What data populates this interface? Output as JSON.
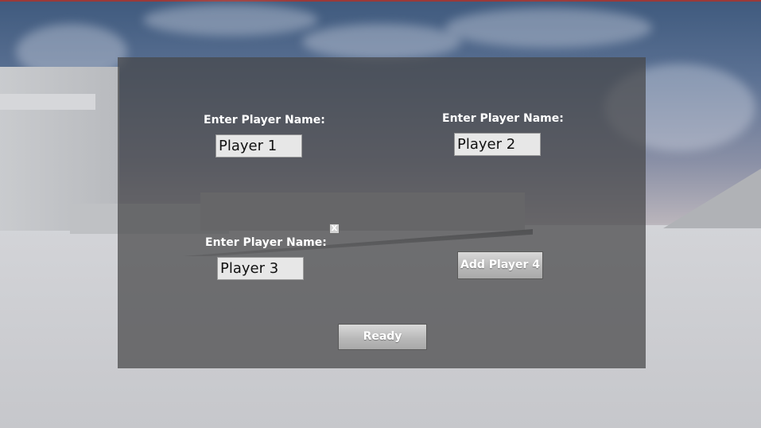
{
  "menu": {
    "slots": [
      {
        "label": "Enter Player Name:",
        "value": "Player 1"
      },
      {
        "label": "Enter Player Name:",
        "value": "Player 2"
      },
      {
        "label": "Enter Player Name:",
        "value": "Player 3"
      }
    ],
    "remove_label": "X",
    "add_player_label": "Add Player 4",
    "ready_label": "Ready"
  },
  "colors": {
    "panel_overlay": "#464648",
    "input_background": "#e7e7e7",
    "button_face": "#c0c0c0",
    "text_light": "#ffffff"
  }
}
